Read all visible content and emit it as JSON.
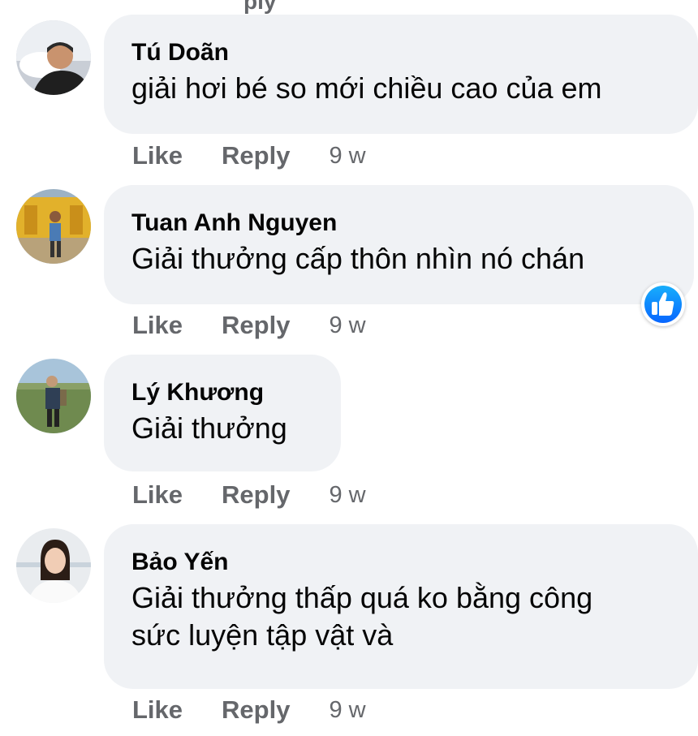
{
  "top_fragment": "ply",
  "comments": [
    {
      "author": "Tú Doãn",
      "text": "giải hơi bé so mới chiều cao của em",
      "like": "Like",
      "reply": "Reply",
      "time": "9 w",
      "avatar": "man-lying-on-pillow-photo"
    },
    {
      "author": "Tuan Anh Nguyen",
      "text": "Giải thưởng cấp thôn nhìn nó chán",
      "like": "Like",
      "reply": "Reply",
      "time": "9 w",
      "avatar": "person-in-front-of-yellow-temple-photo",
      "reaction": "like-reaction-icon"
    },
    {
      "author": "Lý Khương",
      "text": "Giải thưởng",
      "like": "Like",
      "reply": "Reply",
      "time": "9 w",
      "avatar": "person-in-field-photo"
    },
    {
      "author": "Bảo Yến",
      "text": "Giải thưởng thấp quá ko bằng công sức luyện tập vật và",
      "text_line1": "Giải thưởng thấp quá ko bằng công",
      "text_line2": "sức luyện tập vật và",
      "like": "Like",
      "reply": "Reply",
      "time": "9 w",
      "avatar": "woman-portrait-photo"
    }
  ],
  "colors": {
    "bubble": "#f0f2f5",
    "secondary_text": "#65676b",
    "like_blue": "#0866ff"
  }
}
